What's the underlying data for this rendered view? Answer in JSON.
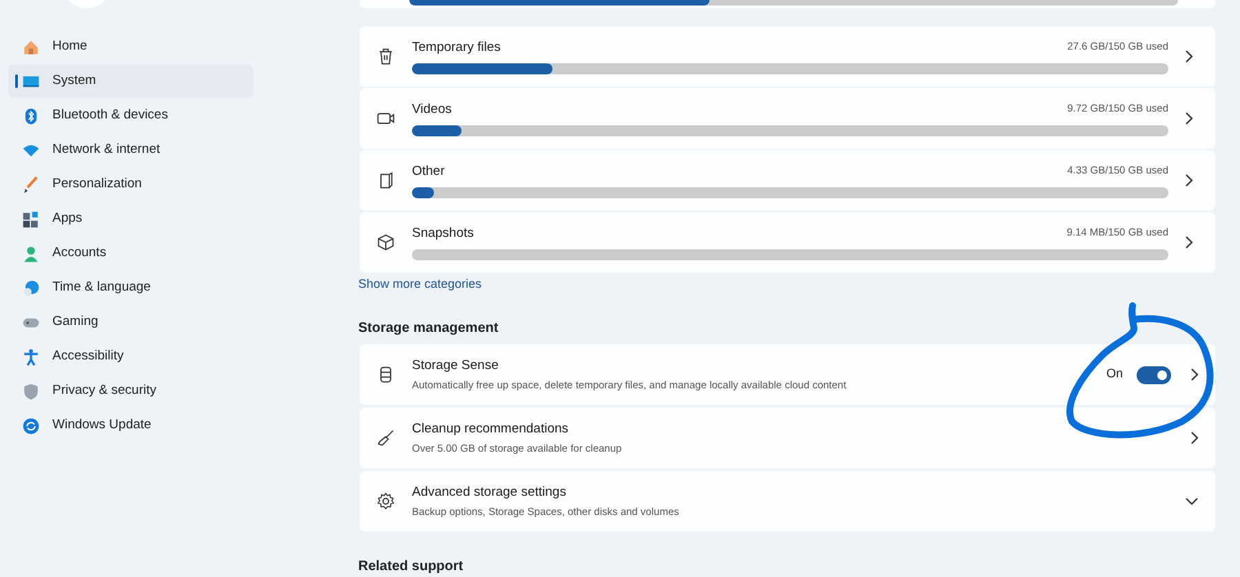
{
  "sidebar": {
    "items": [
      {
        "label": "Home",
        "selected": false
      },
      {
        "label": "System",
        "selected": true
      },
      {
        "label": "Bluetooth & devices",
        "selected": false
      },
      {
        "label": "Network & internet",
        "selected": false
      },
      {
        "label": "Personalization",
        "selected": false
      },
      {
        "label": "Apps",
        "selected": false
      },
      {
        "label": "Accounts",
        "selected": false
      },
      {
        "label": "Time & language",
        "selected": false
      },
      {
        "label": "Gaming",
        "selected": false
      },
      {
        "label": "Accessibility",
        "selected": false
      },
      {
        "label": "Privacy & security",
        "selected": false
      },
      {
        "label": "Windows Update",
        "selected": false
      }
    ]
  },
  "categories": [
    {
      "kind": "partial",
      "level": 0.39
    },
    {
      "kind": "full",
      "name": "Temporary files",
      "usage": "27.6 GB/150 GB used",
      "level": 0.185
    },
    {
      "kind": "full",
      "name": "Videos",
      "usage": "9.72 GB/150 GB used",
      "level": 0.065
    },
    {
      "kind": "full",
      "name": "Other",
      "usage": "4.33 GB/150 GB used",
      "level": 0.029
    },
    {
      "kind": "full",
      "name": "Snapshots",
      "usage": "9.14 MB/150 GB used"
    }
  ],
  "show_more": "Show more categories",
  "storage_management": {
    "title": "Storage management",
    "items": [
      {
        "kind": "toggle",
        "title": "Storage Sense",
        "description": "Automatically free up space, delete temporary files, and manage locally available cloud content",
        "state": "On",
        "on": true
      },
      {
        "kind": "link",
        "title": "Cleanup recommendations",
        "description": "Over 5.00 GB of storage available for cleanup"
      },
      {
        "kind": "expand",
        "title": "Advanced storage settings",
        "description": "Backup options, Storage Spaces, other disks and volumes"
      }
    ]
  },
  "related_support": {
    "title": "Related support"
  }
}
